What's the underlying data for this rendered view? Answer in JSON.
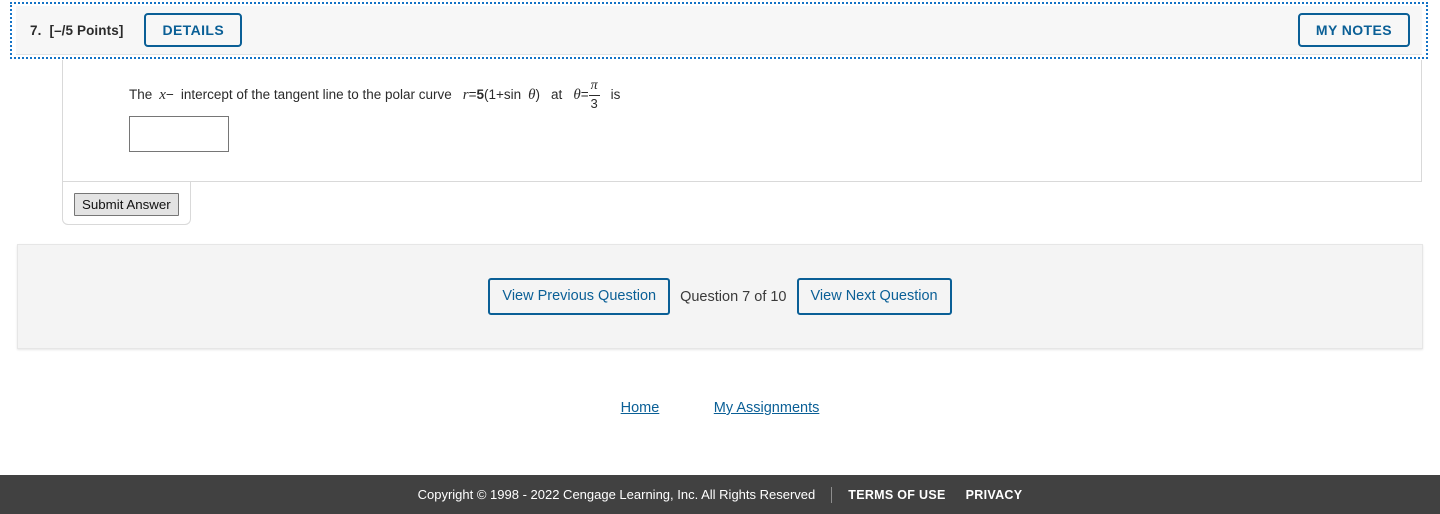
{
  "question_header": {
    "number": "7.",
    "points": "[–/5 Points]",
    "details_label": "DETAILS",
    "my_notes_label": "MY NOTES"
  },
  "question": {
    "prefix": "The",
    "variable": "x",
    "minus": "−",
    "middle": "intercept of the tangent line to the polar curve",
    "equation_lhs": "r",
    "equation_eq": "=",
    "equation_coef": "5",
    "equation_rest": "(1+sin",
    "equation_theta": "θ",
    "equation_close": ")",
    "at": "at",
    "theta": "θ",
    "theta_eq": "=",
    "frac_num": "π",
    "frac_den": "3",
    "suffix": "is",
    "answer_value": "",
    "answer_placeholder": ""
  },
  "submit": {
    "label": "Submit Answer"
  },
  "navigation": {
    "previous_label": "View Previous Question",
    "status": "Question 7 of 10",
    "next_label": "View Next Question"
  },
  "mid_links": {
    "home": "Home",
    "my_assignments": "My Assignments"
  },
  "footer": {
    "copyright": "Copyright © 1998 - 2022 Cengage Learning, Inc. All Rights Reserved",
    "terms": "TERMS OF USE",
    "privacy": "PRIVACY"
  },
  "colors": {
    "accent_blue": "#0a5f96",
    "link_blue": "#0a5f96",
    "focus_blue": "#1473c6",
    "footer_bg": "#414141",
    "header_bg": "#f7f7f7",
    "panel_bg": "#f4f4f4"
  }
}
